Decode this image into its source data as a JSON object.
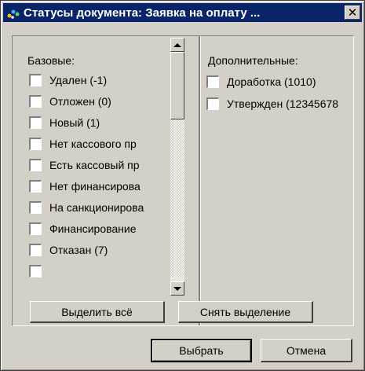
{
  "window": {
    "title": "Статусы документа: Заявка на оплату ..."
  },
  "base": {
    "label": "Базовые:",
    "items": [
      {
        "label": "Удален (-1)",
        "checked": false
      },
      {
        "label": "Отложен (0)",
        "checked": false
      },
      {
        "label": "Новый (1)",
        "checked": false
      },
      {
        "label": "Нет кассового пр",
        "checked": false
      },
      {
        "label": "Есть кассовый пр",
        "checked": false
      },
      {
        "label": "Нет финансирова",
        "checked": false
      },
      {
        "label": "На санкционирова",
        "checked": false
      },
      {
        "label": "Финансирование",
        "checked": false
      },
      {
        "label": "Отказан (7)",
        "checked": false
      }
    ]
  },
  "additional": {
    "label": "Дополнительные:",
    "items": [
      {
        "label": "Доработка (1010)",
        "checked": false
      },
      {
        "label": "Утвержден (12345678",
        "checked": false
      }
    ]
  },
  "buttons": {
    "select_all": "Выделить всё",
    "deselect": "Снять выделение",
    "choose": "Выбрать",
    "cancel": "Отмена"
  }
}
